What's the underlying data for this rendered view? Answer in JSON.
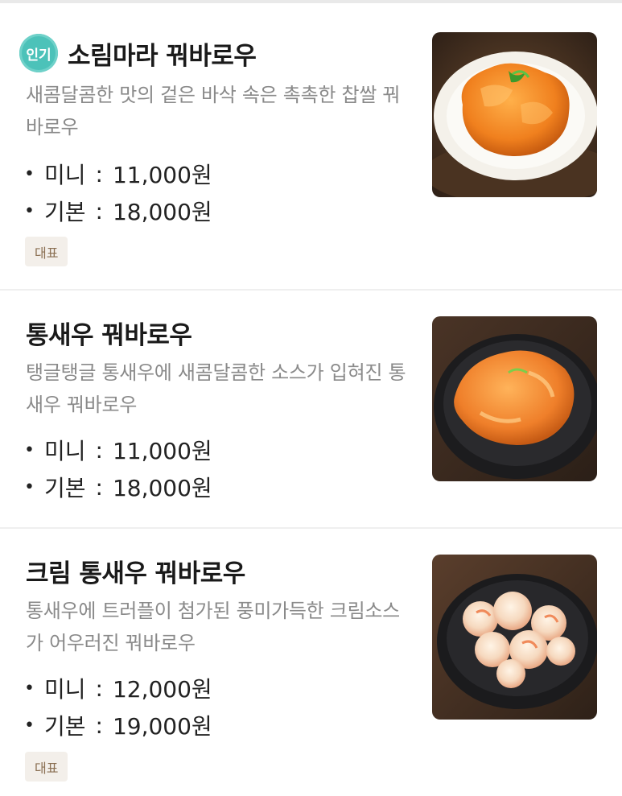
{
  "items": [
    {
      "badge": "인기",
      "name": "소림마라 꿔바로우",
      "desc": "새콤달콤한 맛의 겉은 바삭 속은 촉촉한 찹쌀 꿔바로우",
      "prices": [
        {
          "label": "미니",
          "value": "11,000원"
        },
        {
          "label": "기본",
          "value": "18,000원"
        }
      ],
      "tag": "대표",
      "image": "pork-dish-photo"
    },
    {
      "name": "통새우 꿔바로우",
      "desc": "탱글탱글 통새우에 새콤달콤한 소스가 입혀진 통새우 꿔바로우",
      "prices": [
        {
          "label": "미니",
          "value": "11,000원"
        },
        {
          "label": "기본",
          "value": "18,000원"
        }
      ],
      "image": "shrimp-dish-photo"
    },
    {
      "name": "크림 통새우 꿔바로우",
      "desc": "통새우에 트러플이 첨가된 풍미가득한 크림소스가 어우러진 꿔바로우",
      "prices": [
        {
          "label": "미니",
          "value": "12,000원"
        },
        {
          "label": "기본",
          "value": "19,000원"
        }
      ],
      "tag": "대표",
      "image": "cream-shrimp-dish-photo"
    }
  ],
  "colors": {
    "badge": "#4cc2b9",
    "tag_bg": "#f3efea",
    "tag_text": "#8a6f52",
    "desc_text": "#8a8a8a"
  }
}
